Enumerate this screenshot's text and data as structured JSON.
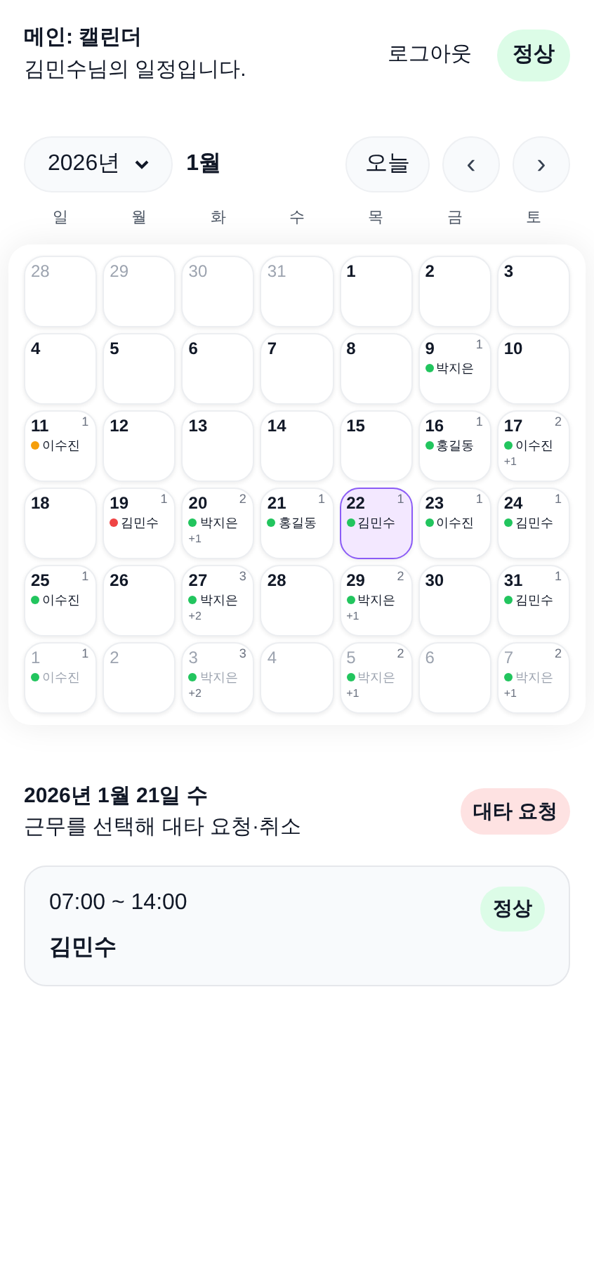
{
  "header": {
    "title": "메인: 캘린더",
    "subtitle": "김민수님의 일정입니다.",
    "logout": "로그아웃",
    "status": "정상"
  },
  "toolbar": {
    "year": "2026년",
    "month": "1월",
    "today": "오늘",
    "prev": "‹",
    "next": "›"
  },
  "weekdays": [
    "일",
    "월",
    "화",
    "수",
    "목",
    "금",
    "토"
  ],
  "days": [
    {
      "day": "28",
      "in_month": false,
      "selected": false
    },
    {
      "day": "29",
      "in_month": false,
      "selected": false
    },
    {
      "day": "30",
      "in_month": false,
      "selected": false
    },
    {
      "day": "31",
      "in_month": false,
      "selected": false
    },
    {
      "day": "1",
      "in_month": true,
      "selected": false
    },
    {
      "day": "2",
      "in_month": true,
      "selected": false
    },
    {
      "day": "3",
      "in_month": true,
      "selected": false
    },
    {
      "day": "4",
      "in_month": true,
      "selected": false
    },
    {
      "day": "5",
      "in_month": true,
      "selected": false
    },
    {
      "day": "6",
      "in_month": true,
      "selected": false
    },
    {
      "day": "7",
      "in_month": true,
      "selected": false
    },
    {
      "day": "8",
      "in_month": true,
      "selected": false
    },
    {
      "day": "9",
      "in_month": true,
      "selected": false,
      "count": "1",
      "entry": {
        "name": "박지은",
        "color": "#22c55e"
      }
    },
    {
      "day": "10",
      "in_month": true,
      "selected": false
    },
    {
      "day": "11",
      "in_month": true,
      "selected": false,
      "count": "1",
      "entry": {
        "name": "이수진",
        "color": "#f59e0b"
      }
    },
    {
      "day": "12",
      "in_month": true,
      "selected": false
    },
    {
      "day": "13",
      "in_month": true,
      "selected": false
    },
    {
      "day": "14",
      "in_month": true,
      "selected": false
    },
    {
      "day": "15",
      "in_month": true,
      "selected": false
    },
    {
      "day": "16",
      "in_month": true,
      "selected": false,
      "count": "1",
      "entry": {
        "name": "홍길동",
        "color": "#22c55e"
      }
    },
    {
      "day": "17",
      "in_month": true,
      "selected": false,
      "count": "2",
      "entry": {
        "name": "이수진",
        "color": "#22c55e"
      },
      "more": "+1"
    },
    {
      "day": "18",
      "in_month": true,
      "selected": false
    },
    {
      "day": "19",
      "in_month": true,
      "selected": false,
      "count": "1",
      "entry": {
        "name": "김민수",
        "color": "#ef4444"
      }
    },
    {
      "day": "20",
      "in_month": true,
      "selected": false,
      "count": "2",
      "entry": {
        "name": "박지은",
        "color": "#22c55e"
      },
      "more": "+1"
    },
    {
      "day": "21",
      "in_month": true,
      "selected": false,
      "count": "1",
      "entry": {
        "name": "홍길동",
        "color": "#22c55e"
      }
    },
    {
      "day": "22",
      "in_month": true,
      "selected": true,
      "count": "1",
      "entry": {
        "name": "김민수",
        "color": "#22c55e"
      }
    },
    {
      "day": "23",
      "in_month": true,
      "selected": false,
      "count": "1",
      "entry": {
        "name": "이수진",
        "color": "#22c55e"
      }
    },
    {
      "day": "24",
      "in_month": true,
      "selected": false,
      "count": "1",
      "entry": {
        "name": "김민수",
        "color": "#22c55e"
      }
    },
    {
      "day": "25",
      "in_month": true,
      "selected": false,
      "count": "1",
      "entry": {
        "name": "이수진",
        "color": "#22c55e"
      }
    },
    {
      "day": "26",
      "in_month": true,
      "selected": false
    },
    {
      "day": "27",
      "in_month": true,
      "selected": false,
      "count": "3",
      "entry": {
        "name": "박지은",
        "color": "#22c55e"
      },
      "more": "+2"
    },
    {
      "day": "28",
      "in_month": true,
      "selected": false
    },
    {
      "day": "29",
      "in_month": true,
      "selected": false,
      "count": "2",
      "entry": {
        "name": "박지은",
        "color": "#22c55e"
      },
      "more": "+1"
    },
    {
      "day": "30",
      "in_month": true,
      "selected": false
    },
    {
      "day": "31",
      "in_month": true,
      "selected": false,
      "count": "1",
      "entry": {
        "name": "김민수",
        "color": "#22c55e"
      }
    },
    {
      "day": "1",
      "in_month": false,
      "selected": false,
      "count": "1",
      "entry": {
        "name": "이수진",
        "color": "#22c55e"
      }
    },
    {
      "day": "2",
      "in_month": false,
      "selected": false
    },
    {
      "day": "3",
      "in_month": false,
      "selected": false,
      "count": "3",
      "entry": {
        "name": "박지은",
        "color": "#22c55e"
      },
      "more": "+2"
    },
    {
      "day": "4",
      "in_month": false,
      "selected": false
    },
    {
      "day": "5",
      "in_month": false,
      "selected": false,
      "count": "2",
      "entry": {
        "name": "박지은",
        "color": "#22c55e"
      },
      "more": "+1"
    },
    {
      "day": "6",
      "in_month": false,
      "selected": false
    },
    {
      "day": "7",
      "in_month": false,
      "selected": false,
      "count": "2",
      "entry": {
        "name": "박지은",
        "color": "#22c55e"
      },
      "more": "+1"
    }
  ],
  "detail": {
    "date": "2026년 1월 21일 수",
    "hint": "근무를 선택해 대타 요청·취소",
    "request": "대타 요청",
    "shifts": [
      {
        "time": "07:00 ~ 14:00",
        "name": "김민수",
        "status": "정상"
      }
    ]
  }
}
